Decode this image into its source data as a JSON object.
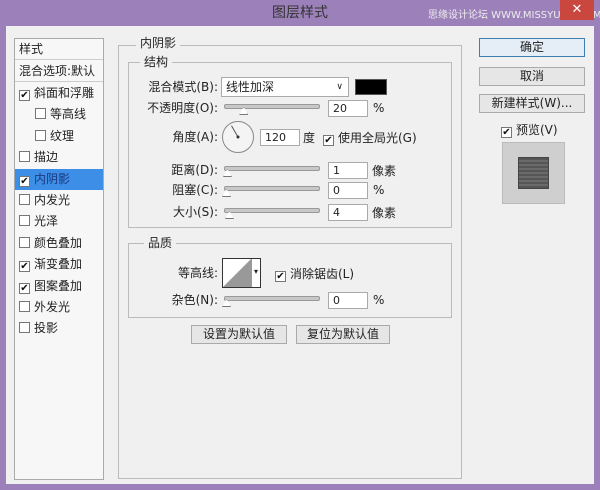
{
  "window": {
    "title": "图层样式",
    "watermark": "思缘设计论坛 WWW.MISSYUAN.COM",
    "close": "✕"
  },
  "sidebar": {
    "header": "样式",
    "blend_options": "混合选项:默认",
    "items": [
      {
        "label": "斜面和浮雕",
        "checked": true,
        "indent": false
      },
      {
        "label": "等高线",
        "checked": false,
        "indent": true
      },
      {
        "label": "纹理",
        "checked": false,
        "indent": true
      },
      {
        "label": "描边",
        "checked": false,
        "indent": false
      },
      {
        "label": "内阴影",
        "checked": true,
        "indent": false,
        "selected": true
      },
      {
        "label": "内发光",
        "checked": false,
        "indent": false
      },
      {
        "label": "光泽",
        "checked": false,
        "indent": false
      },
      {
        "label": "颜色叠加",
        "checked": false,
        "indent": false
      },
      {
        "label": "渐变叠加",
        "checked": true,
        "indent": false
      },
      {
        "label": "图案叠加",
        "checked": true,
        "indent": false
      },
      {
        "label": "外发光",
        "checked": false,
        "indent": false
      },
      {
        "label": "投影",
        "checked": false,
        "indent": false
      }
    ]
  },
  "panel": {
    "title": "内阴影",
    "structure": {
      "title": "结构",
      "blend_mode_label": "混合模式(B):",
      "blend_mode": "线性加深",
      "color": "#000000",
      "opacity_label": "不透明度(O):",
      "opacity": "20",
      "opacity_unit": "%",
      "angle_label": "角度(A):",
      "angle": "120",
      "angle_unit": "度",
      "global_light_label": "使用全局光(G)",
      "global_light": true,
      "distance_label": "距离(D):",
      "distance": "1",
      "distance_unit": "像素",
      "choke_label": "阻塞(C):",
      "choke": "0",
      "choke_unit": "%",
      "size_label": "大小(S):",
      "size": "4",
      "size_unit": "像素"
    },
    "quality": {
      "title": "品质",
      "contour_label": "等高线:",
      "antialias_label": "消除锯齿(L)",
      "antialias": true,
      "noise_label": "杂色(N):",
      "noise": "0",
      "noise_unit": "%"
    },
    "make_default": "设置为默认值",
    "reset_default": "复位为默认值"
  },
  "actions": {
    "ok": "确定",
    "cancel": "取消",
    "new_style": "新建样式(W)...",
    "preview_label": "预览(V)",
    "preview": true
  },
  "colors": {
    "titlebar": "#9c80b9",
    "selection": "#3c8ee6"
  }
}
